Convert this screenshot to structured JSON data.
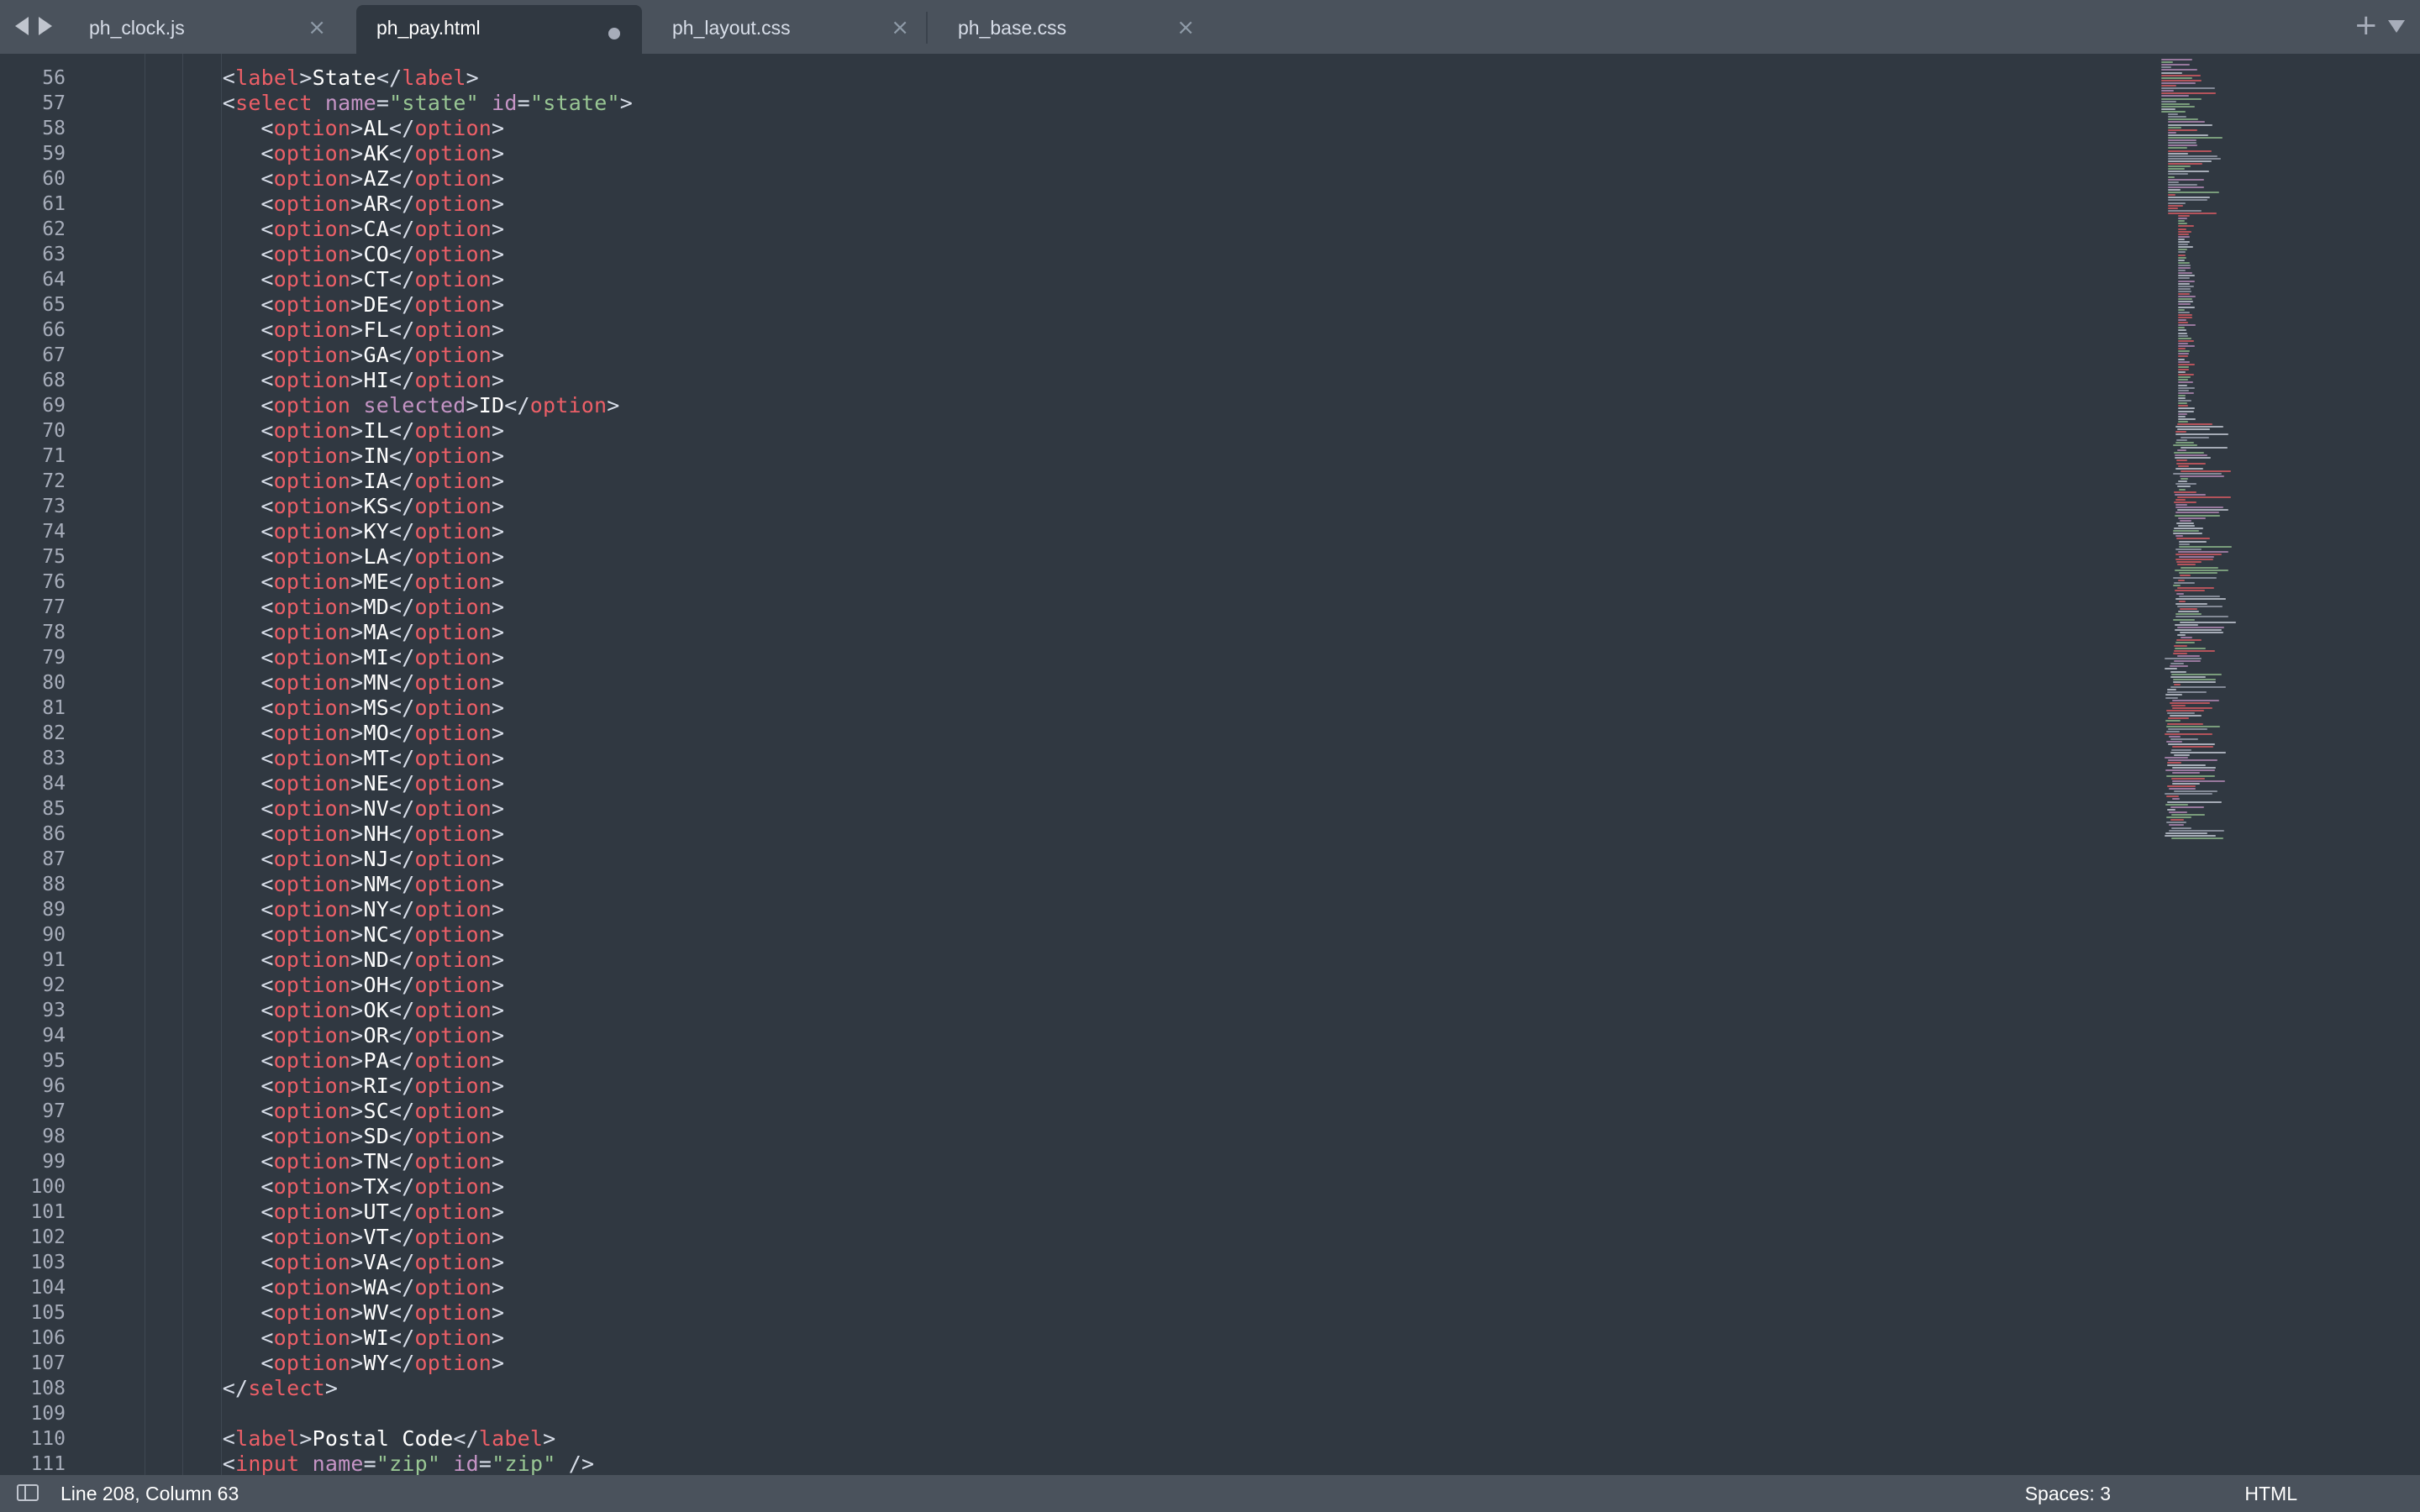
{
  "tabs": [
    {
      "label": "ph_clock.js",
      "active": false,
      "dirty": false
    },
    {
      "label": "ph_pay.html",
      "active": true,
      "dirty": true
    },
    {
      "label": "ph_layout.css",
      "active": false,
      "dirty": false
    },
    {
      "label": "ph_base.css",
      "active": false,
      "dirty": false
    }
  ],
  "tab_close_glyph": "×",
  "tabbar": {
    "new_tab_glyph": "+"
  },
  "editor": {
    "lines": [
      {
        "n": "56",
        "indent": 3,
        "tokens": [
          [
            "p",
            "<"
          ],
          [
            "tag",
            "label"
          ],
          [
            "p",
            ">"
          ],
          [
            "txt",
            "State"
          ],
          [
            "p",
            "</"
          ],
          [
            "tag",
            "label"
          ],
          [
            "p",
            ">"
          ]
        ]
      },
      {
        "n": "57",
        "indent": 3,
        "tokens": [
          [
            "p",
            "<"
          ],
          [
            "tag",
            "select"
          ],
          [
            "p",
            " "
          ],
          [
            "attr",
            "name"
          ],
          [
            "p",
            "="
          ],
          [
            "str",
            "\"state\""
          ],
          [
            "p",
            " "
          ],
          [
            "attr",
            "id"
          ],
          [
            "p",
            "="
          ],
          [
            "str",
            "\"state\""
          ],
          [
            "p",
            ">"
          ]
        ]
      },
      {
        "n": "58",
        "indent": 4,
        "opt": "AL"
      },
      {
        "n": "59",
        "indent": 4,
        "opt": "AK"
      },
      {
        "n": "60",
        "indent": 4,
        "opt": "AZ"
      },
      {
        "n": "61",
        "indent": 4,
        "opt": "AR"
      },
      {
        "n": "62",
        "indent": 4,
        "opt": "CA"
      },
      {
        "n": "63",
        "indent": 4,
        "opt": "CO"
      },
      {
        "n": "64",
        "indent": 4,
        "opt": "CT"
      },
      {
        "n": "65",
        "indent": 4,
        "opt": "DE"
      },
      {
        "n": "66",
        "indent": 4,
        "opt": "FL"
      },
      {
        "n": "67",
        "indent": 4,
        "opt": "GA"
      },
      {
        "n": "68",
        "indent": 4,
        "opt": "HI"
      },
      {
        "n": "69",
        "indent": 4,
        "tokens": [
          [
            "p",
            "<"
          ],
          [
            "tag",
            "option"
          ],
          [
            "p",
            " "
          ],
          [
            "attr",
            "selected"
          ],
          [
            "p",
            ">"
          ],
          [
            "txt",
            "ID"
          ],
          [
            "p",
            "</"
          ],
          [
            "tag",
            "option"
          ],
          [
            "p",
            ">"
          ]
        ]
      },
      {
        "n": "70",
        "indent": 4,
        "opt": "IL"
      },
      {
        "n": "71",
        "indent": 4,
        "opt": "IN"
      },
      {
        "n": "72",
        "indent": 4,
        "opt": "IA"
      },
      {
        "n": "73",
        "indent": 4,
        "opt": "KS"
      },
      {
        "n": "74",
        "indent": 4,
        "opt": "KY"
      },
      {
        "n": "75",
        "indent": 4,
        "opt": "LA"
      },
      {
        "n": "76",
        "indent": 4,
        "opt": "ME"
      },
      {
        "n": "77",
        "indent": 4,
        "opt": "MD"
      },
      {
        "n": "78",
        "indent": 4,
        "opt": "MA"
      },
      {
        "n": "79",
        "indent": 4,
        "opt": "MI"
      },
      {
        "n": "80",
        "indent": 4,
        "opt": "MN"
      },
      {
        "n": "81",
        "indent": 4,
        "opt": "MS"
      },
      {
        "n": "82",
        "indent": 4,
        "opt": "MO"
      },
      {
        "n": "83",
        "indent": 4,
        "opt": "MT"
      },
      {
        "n": "84",
        "indent": 4,
        "opt": "NE"
      },
      {
        "n": "85",
        "indent": 4,
        "opt": "NV"
      },
      {
        "n": "86",
        "indent": 4,
        "opt": "NH"
      },
      {
        "n": "87",
        "indent": 4,
        "opt": "NJ"
      },
      {
        "n": "88",
        "indent": 4,
        "opt": "NM"
      },
      {
        "n": "89",
        "indent": 4,
        "opt": "NY"
      },
      {
        "n": "90",
        "indent": 4,
        "opt": "NC"
      },
      {
        "n": "91",
        "indent": 4,
        "opt": "ND"
      },
      {
        "n": "92",
        "indent": 4,
        "opt": "OH"
      },
      {
        "n": "93",
        "indent": 4,
        "opt": "OK"
      },
      {
        "n": "94",
        "indent": 4,
        "opt": "OR"
      },
      {
        "n": "95",
        "indent": 4,
        "opt": "PA"
      },
      {
        "n": "96",
        "indent": 4,
        "opt": "RI"
      },
      {
        "n": "97",
        "indent": 4,
        "opt": "SC"
      },
      {
        "n": "98",
        "indent": 4,
        "opt": "SD"
      },
      {
        "n": "99",
        "indent": 4,
        "opt": "TN"
      },
      {
        "n": "100",
        "indent": 4,
        "opt": "TX"
      },
      {
        "n": "101",
        "indent": 4,
        "opt": "UT"
      },
      {
        "n": "102",
        "indent": 4,
        "opt": "VT"
      },
      {
        "n": "103",
        "indent": 4,
        "opt": "VA"
      },
      {
        "n": "104",
        "indent": 4,
        "opt": "WA"
      },
      {
        "n": "105",
        "indent": 4,
        "opt": "WV"
      },
      {
        "n": "106",
        "indent": 4,
        "opt": "WI"
      },
      {
        "n": "107",
        "indent": 4,
        "opt": "WY"
      },
      {
        "n": "108",
        "indent": 3,
        "tokens": [
          [
            "p",
            "</"
          ],
          [
            "tag",
            "select"
          ],
          [
            "p",
            ">"
          ]
        ]
      },
      {
        "n": "109",
        "indent": 3,
        "tokens": []
      },
      {
        "n": "110",
        "indent": 3,
        "tokens": [
          [
            "p",
            "<"
          ],
          [
            "tag",
            "label"
          ],
          [
            "p",
            ">"
          ],
          [
            "txt",
            "Postal Code"
          ],
          [
            "p",
            "</"
          ],
          [
            "tag",
            "label"
          ],
          [
            "p",
            ">"
          ]
        ]
      },
      {
        "n": "111",
        "indent": 3,
        "tokens": [
          [
            "p",
            "<"
          ],
          [
            "tag",
            "input"
          ],
          [
            "p",
            " "
          ],
          [
            "attr",
            "name"
          ],
          [
            "p",
            "="
          ],
          [
            "str",
            "\"zip\""
          ],
          [
            "p",
            " "
          ],
          [
            "attr",
            "id"
          ],
          [
            "p",
            "="
          ],
          [
            "str",
            "\"zip\""
          ],
          [
            "p",
            " />"
          ]
        ]
      }
    ]
  },
  "colors": {
    "background": "#303841",
    "bar": "#4a525c",
    "punctuation": "#d8dee9",
    "tag": "#ec5f67",
    "attribute": "#c594c5",
    "string": "#99c794",
    "text": "#ffffff",
    "gutter": "#a7adba"
  },
  "status": {
    "position": "Line 208, Column 63",
    "indentation": "Spaces: 3",
    "syntax": "HTML"
  }
}
